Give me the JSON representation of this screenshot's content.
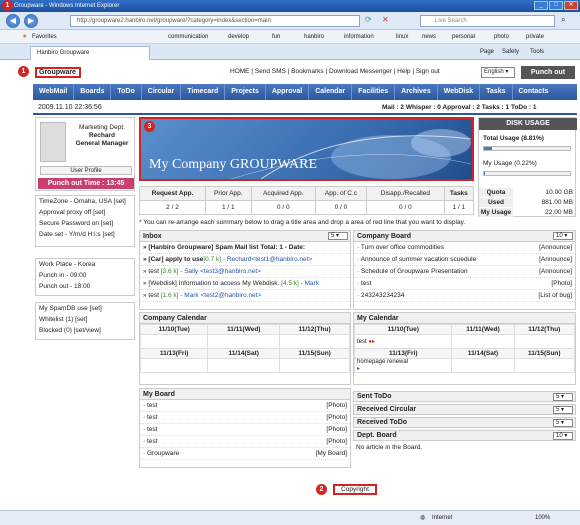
{
  "browser": {
    "window_title": "Groupware - Windows Internet Explorer",
    "address": "http://groupware2.hanbiro.net/groupware/?category=index&section=main",
    "search_placeholder": "Live Search",
    "favorites_label": "Favorites",
    "favlinks": [
      "communication",
      "develop",
      "fun",
      "hanbiro",
      "information",
      "linux",
      "news",
      "personal",
      "photo",
      "private"
    ],
    "tab_label": "Hanbiro Groupware",
    "tool_page": "Page",
    "tool_safety": "Safety",
    "tool_tools": "Tools",
    "status_zone": "Internet",
    "zoom": "100%"
  },
  "header": {
    "logo": "Groupware",
    "toplinks": "HOME | Send SMS | Bookmarks | Download Messenger | Help | Sign out",
    "language": "English",
    "punch_out": "Punch out"
  },
  "menu": [
    "WebMail",
    "Boards",
    "ToDo",
    "Circular",
    "Timecard",
    "Projects",
    "Approval",
    "Calendar",
    "Facilities",
    "Archives",
    "WebDisk",
    "Tasks",
    "Contacts"
  ],
  "datetime": "2009.11.10 22:36:56",
  "status_counts": "Mail : 2   Whisper : 0   Approval : 2   Tasks : 1   ToDo : 1",
  "profile": {
    "dept": "Marketing Dept.",
    "name": "Rechard",
    "role": "General Manager",
    "user_profile": "User Profile",
    "punch_out_time": "Punch out Time : 13:45"
  },
  "settings": {
    "timezone": "TimeZone - Omaha, USA [set]",
    "approval_proxy": "Approval proxy off [set]",
    "secure_password": "Secure Password on [set]",
    "date_set": "Date set - Y/m/d H:i:s [set]"
  },
  "work": {
    "place": "Work Place - Korea",
    "punch_in": "Punch in - 09:00",
    "punch_out": "Punch out - 18:00"
  },
  "spam": {
    "use": "My SpamDB use [set]",
    "whitelist": "Whitelist (1) [set]",
    "blocked": "Blocked (0) [set/view]"
  },
  "banner": {
    "title": "My Company GROUPWARE"
  },
  "disk": {
    "title": "DISK USAGE",
    "total_label": "Total Usage (8.81%)",
    "total_frac": 0.0881,
    "my_label": "My Usage (0.22%)",
    "my_frac": 0.0022,
    "quota_k": "Quota",
    "quota_v": "10.00 GB",
    "used_k": "Used",
    "used_v": "881.00 MB",
    "myusage_k": "My Usage",
    "myusage_v": "22.00 MB"
  },
  "summary": {
    "headers": [
      "Request App.",
      "Prior App.",
      "Acquired App.",
      "App. of C.c",
      "Disapp./Recalled",
      "Tasks"
    ],
    "values": [
      "2 / 2",
      "1 / 1",
      "0 / 0",
      "0 / 0",
      "0 / 0",
      "1 / 1"
    ]
  },
  "hint": "* You can re-arrange each summary below to drag a title area and drop a area of red line that you want to display.",
  "inbox": {
    "title": "Inbox",
    "count": "5",
    "rows": [
      {
        "a": "» [Hanbiro Groupware] Spam Mail list Total: 1 - Date:",
        "b": "",
        "c": ""
      },
      {
        "a": "» [Car] apply to use",
        "b": "[0.7 k]",
        "c": " - Rechard<test1@hanbiro.net>"
      },
      {
        "a": "» test",
        "b": "[3.6 k]",
        "c": " - Sally <test3@hanbiro.net>"
      },
      {
        "a": "» [Webdisk] Information to access My Webdisk.",
        "b": "[4.5 k]",
        "c": " - Mark"
      },
      {
        "a": "» test",
        "b": "[1.6 k]",
        "c": " - Mark <test2@hanbiro.net>"
      }
    ]
  },
  "company_board": {
    "title": "Company Board",
    "count": "10",
    "rows": [
      {
        "t": "· Turn over office commodities",
        "r": "[Announce]"
      },
      {
        "t": "· Announce of summer vacation scuedule",
        "r": "[Announce]"
      },
      {
        "t": "· Schedule of Groupware Presentation",
        "r": "[Announce]"
      },
      {
        "t": "· test",
        "r": "[Photo]"
      },
      {
        "t": "· 243243234234",
        "r": "[List of bug]"
      }
    ]
  },
  "company_calendar": {
    "title": "Company Calendar",
    "week1": [
      "11/10(Tue)",
      "11/11(Wed)",
      "11/12(Thu)"
    ],
    "week2": [
      "11/13(Fri)",
      "11/14(Sat)",
      "11/15(Sun)"
    ]
  },
  "my_calendar": {
    "title": "My Calendar",
    "week1": [
      "11/10(Tue)",
      "11/11(Wed)",
      "11/12(Thu)"
    ],
    "week2": [
      "11/13(Fri)",
      "11/14(Sat)",
      "11/15(Sun)"
    ],
    "event1": "test",
    "event2": "homepage renewal"
  },
  "my_board": {
    "title": "My Board",
    "rows": [
      {
        "t": "· test",
        "r": "[Photo]"
      },
      {
        "t": "· test",
        "r": "[Photo]"
      },
      {
        "t": "· test",
        "r": "[Photo]"
      },
      {
        "t": "· test",
        "r": "[Photo]"
      },
      {
        "t": "· Groupware",
        "r": "[My Board]"
      }
    ]
  },
  "right_boxes": {
    "sent_todo": "Sent ToDo",
    "sent_count": "5",
    "received_circular": "Received Circular",
    "circ_count": "5",
    "received_todo": "Received ToDo",
    "rtodo_count": "5",
    "dept_board": "Dept. Board",
    "dept_count": "10",
    "no_article": "No article in the Board."
  },
  "copyright": "Copyright",
  "markers": {
    "m1": "1",
    "m2": "2",
    "m3": "3"
  }
}
